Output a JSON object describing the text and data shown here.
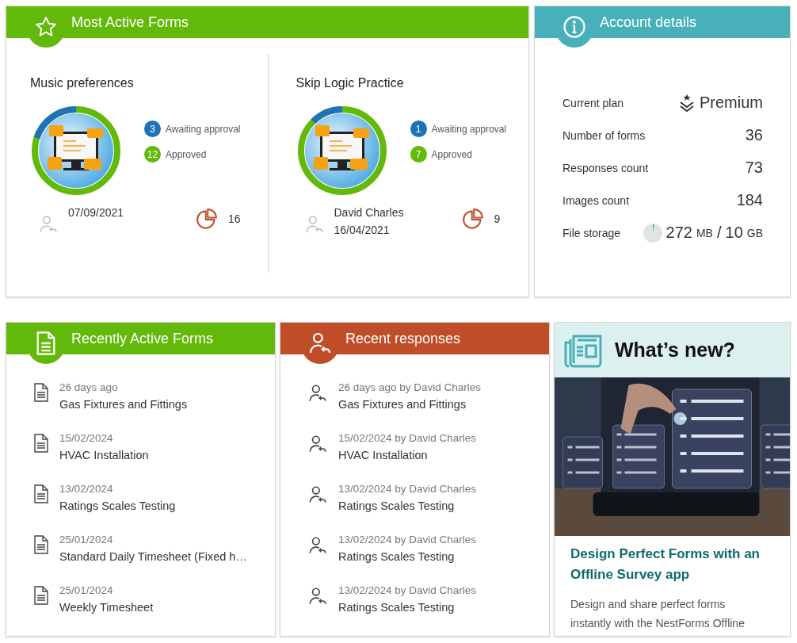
{
  "most_active_forms": {
    "title": "Most Active Forms",
    "forms": [
      {
        "name": "Music preferences",
        "level": 0.2,
        "statuses": [
          {
            "count": "3",
            "label": "Awaiting approval",
            "color": "#1e73b8"
          },
          {
            "count": "12",
            "label": "Approved",
            "color": "#62b90a"
          }
        ],
        "author_lines": [
          "07/09/2021"
        ],
        "responses": "16"
      },
      {
        "name": "Skip Logic Practice",
        "level": 0.125,
        "statuses": [
          {
            "count": "1",
            "label": "Awaiting approval",
            "color": "#1e73b8"
          },
          {
            "count": "7",
            "label": "Approved",
            "color": "#62b90a"
          }
        ],
        "author_lines": [
          "David Charles",
          "16/04/2021"
        ],
        "responses": "9"
      }
    ]
  },
  "account_details": {
    "title": "Account details",
    "rows": [
      {
        "kind": "plan",
        "label": "Current plan",
        "value": "Premium"
      },
      {
        "kind": "number",
        "label": "Number of forms",
        "value": "36"
      },
      {
        "kind": "number",
        "label": "Responses count",
        "value": "73"
      },
      {
        "kind": "number",
        "label": "Images count",
        "value": "184"
      },
      {
        "kind": "storage",
        "label": "File storage",
        "used": "272",
        "used_unit": "MB",
        "separator": "/",
        "total": "10",
        "total_unit": "GB"
      }
    ]
  },
  "recently_active_forms": {
    "title": "Recently Active Forms",
    "items": [
      {
        "when": "26 days ago",
        "name": "Gas Fixtures and Fittings"
      },
      {
        "when": "15/02/2024",
        "name": "HVAC Installation"
      },
      {
        "when": "13/02/2024",
        "name": "Ratings Scales Testing"
      },
      {
        "when": "25/01/2024",
        "name": "Standard Daily Timesheet (Fixed h…"
      },
      {
        "when": "25/01/2024",
        "name": "Weekly Timesheet"
      }
    ]
  },
  "recent_responses": {
    "title": "Recent responses",
    "items": [
      {
        "meta": "26 days ago by David Charles",
        "name": "Gas Fixtures and Fittings"
      },
      {
        "meta": "15/02/2024 by David Charles",
        "name": "HVAC Installation"
      },
      {
        "meta": "13/02/2024 by David Charles",
        "name": "Ratings Scales Testing"
      },
      {
        "meta": "13/02/2024 by David Charles",
        "name": "Ratings Scales Testing"
      },
      {
        "meta": "13/02/2024 by David Charles",
        "name": "Ratings Scales Testing"
      }
    ]
  },
  "whats_new": {
    "title": "What’s new?",
    "article_title": "Design Perfect Forms with an Offline Survey app",
    "article_text": "Design and share perfect forms instantly with the NestForms Offline"
  }
}
